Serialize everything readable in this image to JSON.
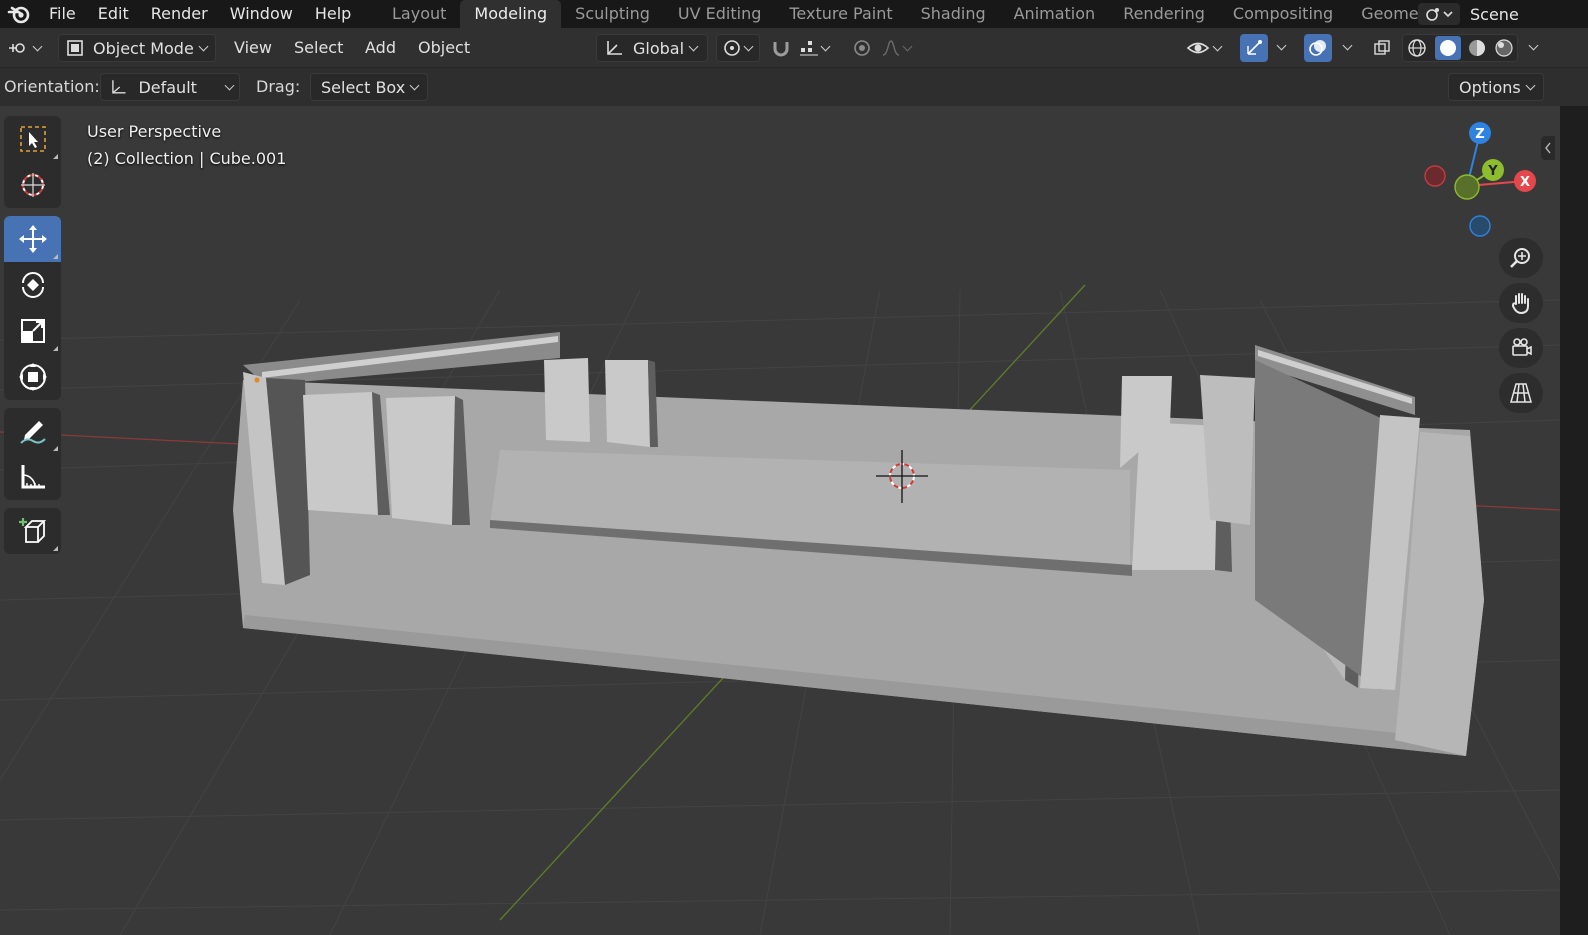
{
  "topbar": {
    "menu": [
      "File",
      "Edit",
      "Render",
      "Window",
      "Help"
    ],
    "workspaces": [
      "Layout",
      "Modeling",
      "Sculpting",
      "UV Editing",
      "Texture Paint",
      "Shading",
      "Animation",
      "Rendering",
      "Compositing",
      "Geome"
    ],
    "active_workspace": "Modeling",
    "scene": "Scene"
  },
  "header": {
    "mode": "Object Mode",
    "menus": [
      "View",
      "Select",
      "Add",
      "Object"
    ],
    "transform_orientation": "Global"
  },
  "tool_settings": {
    "orientation_label": "Orientation:",
    "orientation_value": "Default",
    "drag_label": "Drag:",
    "drag_value": "Select Box",
    "options_label": "Options"
  },
  "viewport": {
    "view_name": "User Perspective",
    "collection_info": "(2) Collection | Cube.001"
  },
  "gizmo": {
    "z_label": "Z",
    "y_label": "Y",
    "x_label": "X"
  },
  "toolbar": {
    "tools": [
      "select-box",
      "cursor",
      "move",
      "rotate",
      "scale",
      "transform",
      "annotate",
      "measure",
      "add-cube"
    ],
    "active": "move"
  },
  "colors": {
    "accent": "#4772b3",
    "axis_x": "#e5474c",
    "axis_y": "#8bbd2d",
    "axis_z": "#2f83e0"
  }
}
